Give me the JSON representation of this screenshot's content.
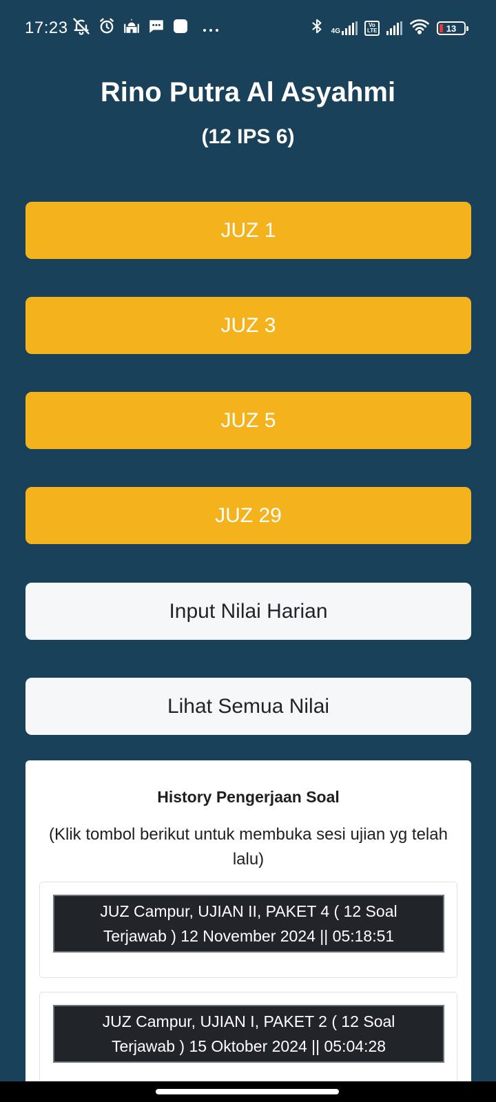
{
  "status_bar": {
    "time": "17:23",
    "network_type": "4G",
    "volte_label": "Vo LTE",
    "battery_level": "13",
    "left_icons": [
      "notifications-off-icon",
      "alarm-icon",
      "mosque-icon",
      "message-icon",
      "app-icon",
      "more-icon"
    ],
    "right_icons": [
      "bluetooth-icon",
      "signal-icon",
      "volte-icon",
      "signal-icon",
      "wifi-icon",
      "battery-icon"
    ]
  },
  "header": {
    "name": "Rino Putra Al Asyahmi",
    "class": "(12 IPS 6)"
  },
  "juz_buttons": [
    {
      "label": "JUZ 1"
    },
    {
      "label": "JUZ 3"
    },
    {
      "label": "JUZ 5"
    },
    {
      "label": "JUZ 29"
    }
  ],
  "actions": {
    "input_label": "Input Nilai Harian",
    "view_label": "Lihat Semua Nilai"
  },
  "history": {
    "title": "History Pengerjaan Soal",
    "subtitle": "(Klik tombol berikut untuk membuka sesi ujian yg telah lalu)",
    "items": [
      {
        "label": "JUZ Campur, UJIAN II, PAKET 4 ( 12 Soal Terjawab ) 12 November 2024 || 05:18:51"
      },
      {
        "label": "JUZ Campur, UJIAN I, PAKET 2 ( 12 Soal Terjawab ) 15 Oktober 2024 || 05:04:28"
      }
    ]
  },
  "colors": {
    "background": "#1a415a",
    "juz_button": "#f4b31d",
    "light_button": "#f5f7f9",
    "history_button": "#212529"
  }
}
